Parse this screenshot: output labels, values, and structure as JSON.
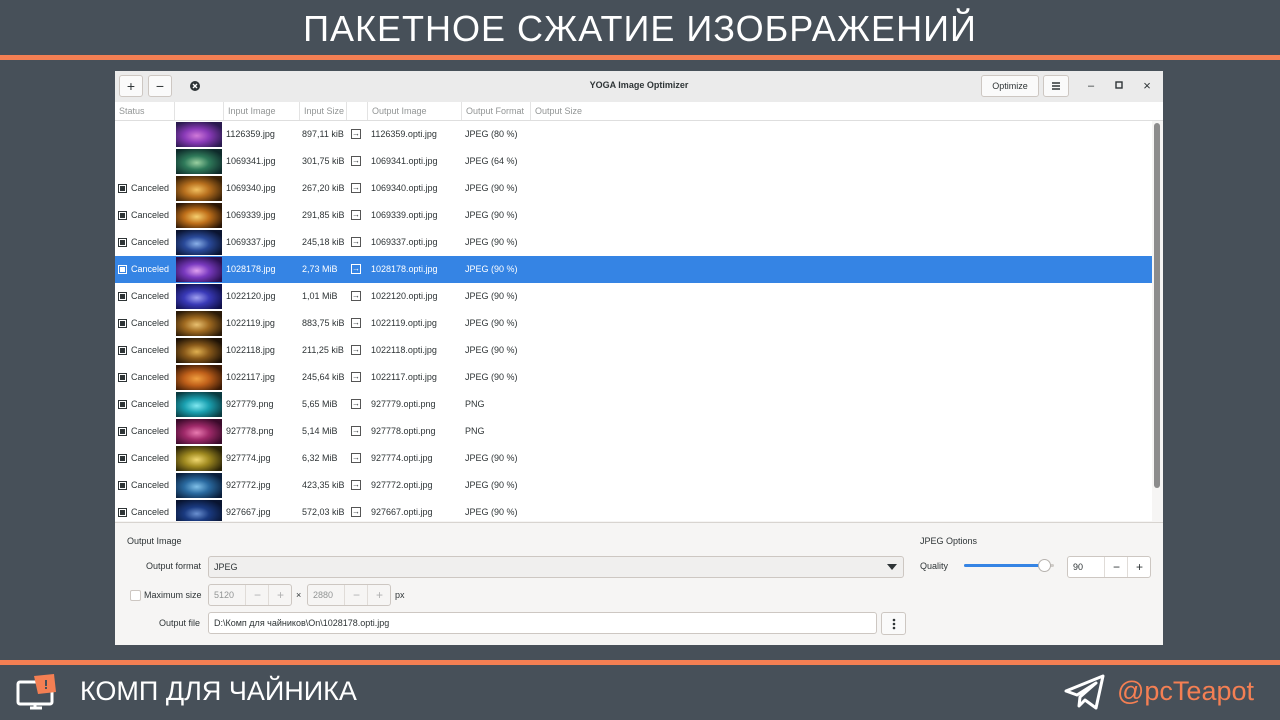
{
  "slide": {
    "title": "ПАКЕТНОЕ СЖАТИЕ ИЗОБРАЖЕНИЙ",
    "brand": "КОМП ДЛЯ ЧАЙНИКА",
    "handle": "@pcTeapot",
    "accent_color": "#f47f53",
    "bg_color": "#475059",
    "brand_icon": "computer-teapot-logo-icon",
    "social_icon": "telegram-plane-icon"
  },
  "window": {
    "title": "YOGA Image Optimizer",
    "add_label": "+",
    "remove_label": "−",
    "clear_icon": "clear-circle-icon",
    "optimize_label": "Optimize",
    "menu_icon": "hamburger-menu-icon",
    "minimize_label": "–",
    "maximize_label": "▫",
    "close_label": "×"
  },
  "table": {
    "columns": [
      "Status",
      "Input Image",
      "Input Size",
      "Output Image",
      "Output Format",
      "Output Size"
    ],
    "rows": [
      {
        "status": "",
        "input": "1126359.jpg",
        "size": "897,11 kiB",
        "output": "1126359.opti.jpg",
        "format": "JPEG (80 %)",
        "thumb": [
          "#2a1a4e",
          "#8a3ab8",
          "#d07ad8"
        ]
      },
      {
        "status": "",
        "input": "1069341.jpg",
        "size": "301,75 kiB",
        "output": "1069341.opti.jpg",
        "format": "JPEG (64 %)",
        "thumb": [
          "#0e2a2a",
          "#2f7a5a",
          "#9ad0a0"
        ]
      },
      {
        "status": "Canceled",
        "input": "1069340.jpg",
        "size": "267,20 kiB",
        "output": "1069340.opti.jpg",
        "format": "JPEG (90 %)",
        "thumb": [
          "#3a2208",
          "#b8701e",
          "#f2c060"
        ]
      },
      {
        "status": "Canceled",
        "input": "1069339.jpg",
        "size": "291,85 kiB",
        "output": "1069339.opti.jpg",
        "format": "JPEG (90 %)",
        "thumb": [
          "#2a1606",
          "#c0701a",
          "#f6d070"
        ]
      },
      {
        "status": "Canceled",
        "input": "1069337.jpg",
        "size": "245,18 kiB",
        "output": "1069337.opti.jpg",
        "format": "JPEG (90 %)",
        "thumb": [
          "#0a1430",
          "#2a4a9a",
          "#8ab0e8"
        ]
      },
      {
        "status": "Canceled",
        "input": "1028178.jpg",
        "size": "2,73 MiB",
        "output": "1028178.opti.jpg",
        "format": "JPEG (90 %)",
        "thumb": [
          "#2a1050",
          "#7a3ac0",
          "#e0a0f0"
        ]
      },
      {
        "status": "Canceled",
        "input": "1022120.jpg",
        "size": "1,01 MiB",
        "output": "1022120.opti.jpg",
        "format": "JPEG (90 %)",
        "thumb": [
          "#10104a",
          "#3a3ab8",
          "#a0a0f0"
        ]
      },
      {
        "status": "Canceled",
        "input": "1022119.jpg",
        "size": "883,75 kiB",
        "output": "1022119.opti.jpg",
        "format": "JPEG (90 %)",
        "thumb": [
          "#2a1a08",
          "#a06a20",
          "#e8c070"
        ]
      },
      {
        "status": "Canceled",
        "input": "1022118.jpg",
        "size": "211,25 kiB",
        "output": "1022118.opti.jpg",
        "format": "JPEG (90 %)",
        "thumb": [
          "#1e1206",
          "#8a5a1a",
          "#e0b050"
        ]
      },
      {
        "status": "Canceled",
        "input": "1022117.jpg",
        "size": "245,64 kiB",
        "output": "1022117.opti.jpg",
        "format": "JPEG (90 %)",
        "thumb": [
          "#3a1a06",
          "#c0601a",
          "#f0a040"
        ]
      },
      {
        "status": "Canceled",
        "input": "927779.png",
        "size": "5,65 MiB",
        "output": "927779.opti.png",
        "format": "PNG",
        "thumb": [
          "#0a3a40",
          "#1aa0b0",
          "#80e8f0"
        ]
      },
      {
        "status": "Canceled",
        "input": "927778.png",
        "size": "5,14 MiB",
        "output": "927778.opti.png",
        "format": "PNG",
        "thumb": [
          "#3a0a2a",
          "#a02a6a",
          "#e87ab0"
        ]
      },
      {
        "status": "Canceled",
        "input": "927774.jpg",
        "size": "6,32 MiB",
        "output": "927774.opti.jpg",
        "format": "JPEG (90 %)",
        "thumb": [
          "#2a2408",
          "#a08a20",
          "#f0d870"
        ]
      },
      {
        "status": "Canceled",
        "input": "927772.jpg",
        "size": "423,35 kiB",
        "output": "927772.opti.jpg",
        "format": "JPEG (90 %)",
        "thumb": [
          "#0a1e3a",
          "#2a6aa0",
          "#80c0e8"
        ]
      },
      {
        "status": "Canceled",
        "input": "927667.jpg",
        "size": "572,03 kiB",
        "output": "927667.opti.jpg",
        "format": "JPEG (90 %)",
        "thumb": [
          "#081430",
          "#1a3a80",
          "#6a90d0"
        ]
      }
    ],
    "selected_index": 5
  },
  "options": {
    "section_output": "Output Image",
    "format_label": "Output format",
    "format_value": "JPEG",
    "maxsize_label": "Maximum size",
    "width_value": "5120",
    "height_value": "2880",
    "times": "×",
    "unit": "px",
    "minus": "−",
    "plus": "+",
    "file_label": "Output file",
    "file_value": "D:\\Комп для чайников\\On\\1028178.opti.jpg",
    "file_menu_icon": "vertical-dots-icon",
    "section_jpeg": "JPEG Options",
    "quality_label": "Quality",
    "quality_value": "90",
    "quality_fraction": 0.9,
    "accent": "#3584e4"
  }
}
